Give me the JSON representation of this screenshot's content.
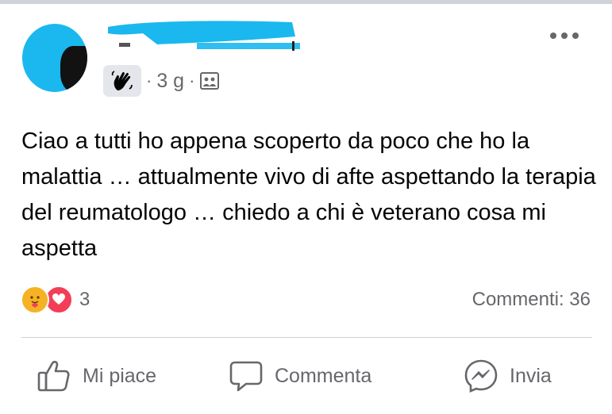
{
  "post": {
    "time_label": "3 g",
    "separator": "·",
    "text": "Ciao a tutti ho appena scoperto da poco che ho la malattia … attualmente vivo di afte aspettando la terapia del reumatologo … chiedo a chi è veterano cosa mi aspetta"
  },
  "reactions": {
    "count": "3",
    "icons": [
      "care-emoji",
      "love-heart"
    ]
  },
  "comments": {
    "label": "Commenti: 36"
  },
  "actions": {
    "like_label": "Mi piace",
    "comment_label": "Commenta",
    "send_label": "Invia"
  },
  "colors": {
    "redaction": "#1ab8ee",
    "secondary_text": "#65676b",
    "love": "#f33e58",
    "care": "#f7b125"
  }
}
